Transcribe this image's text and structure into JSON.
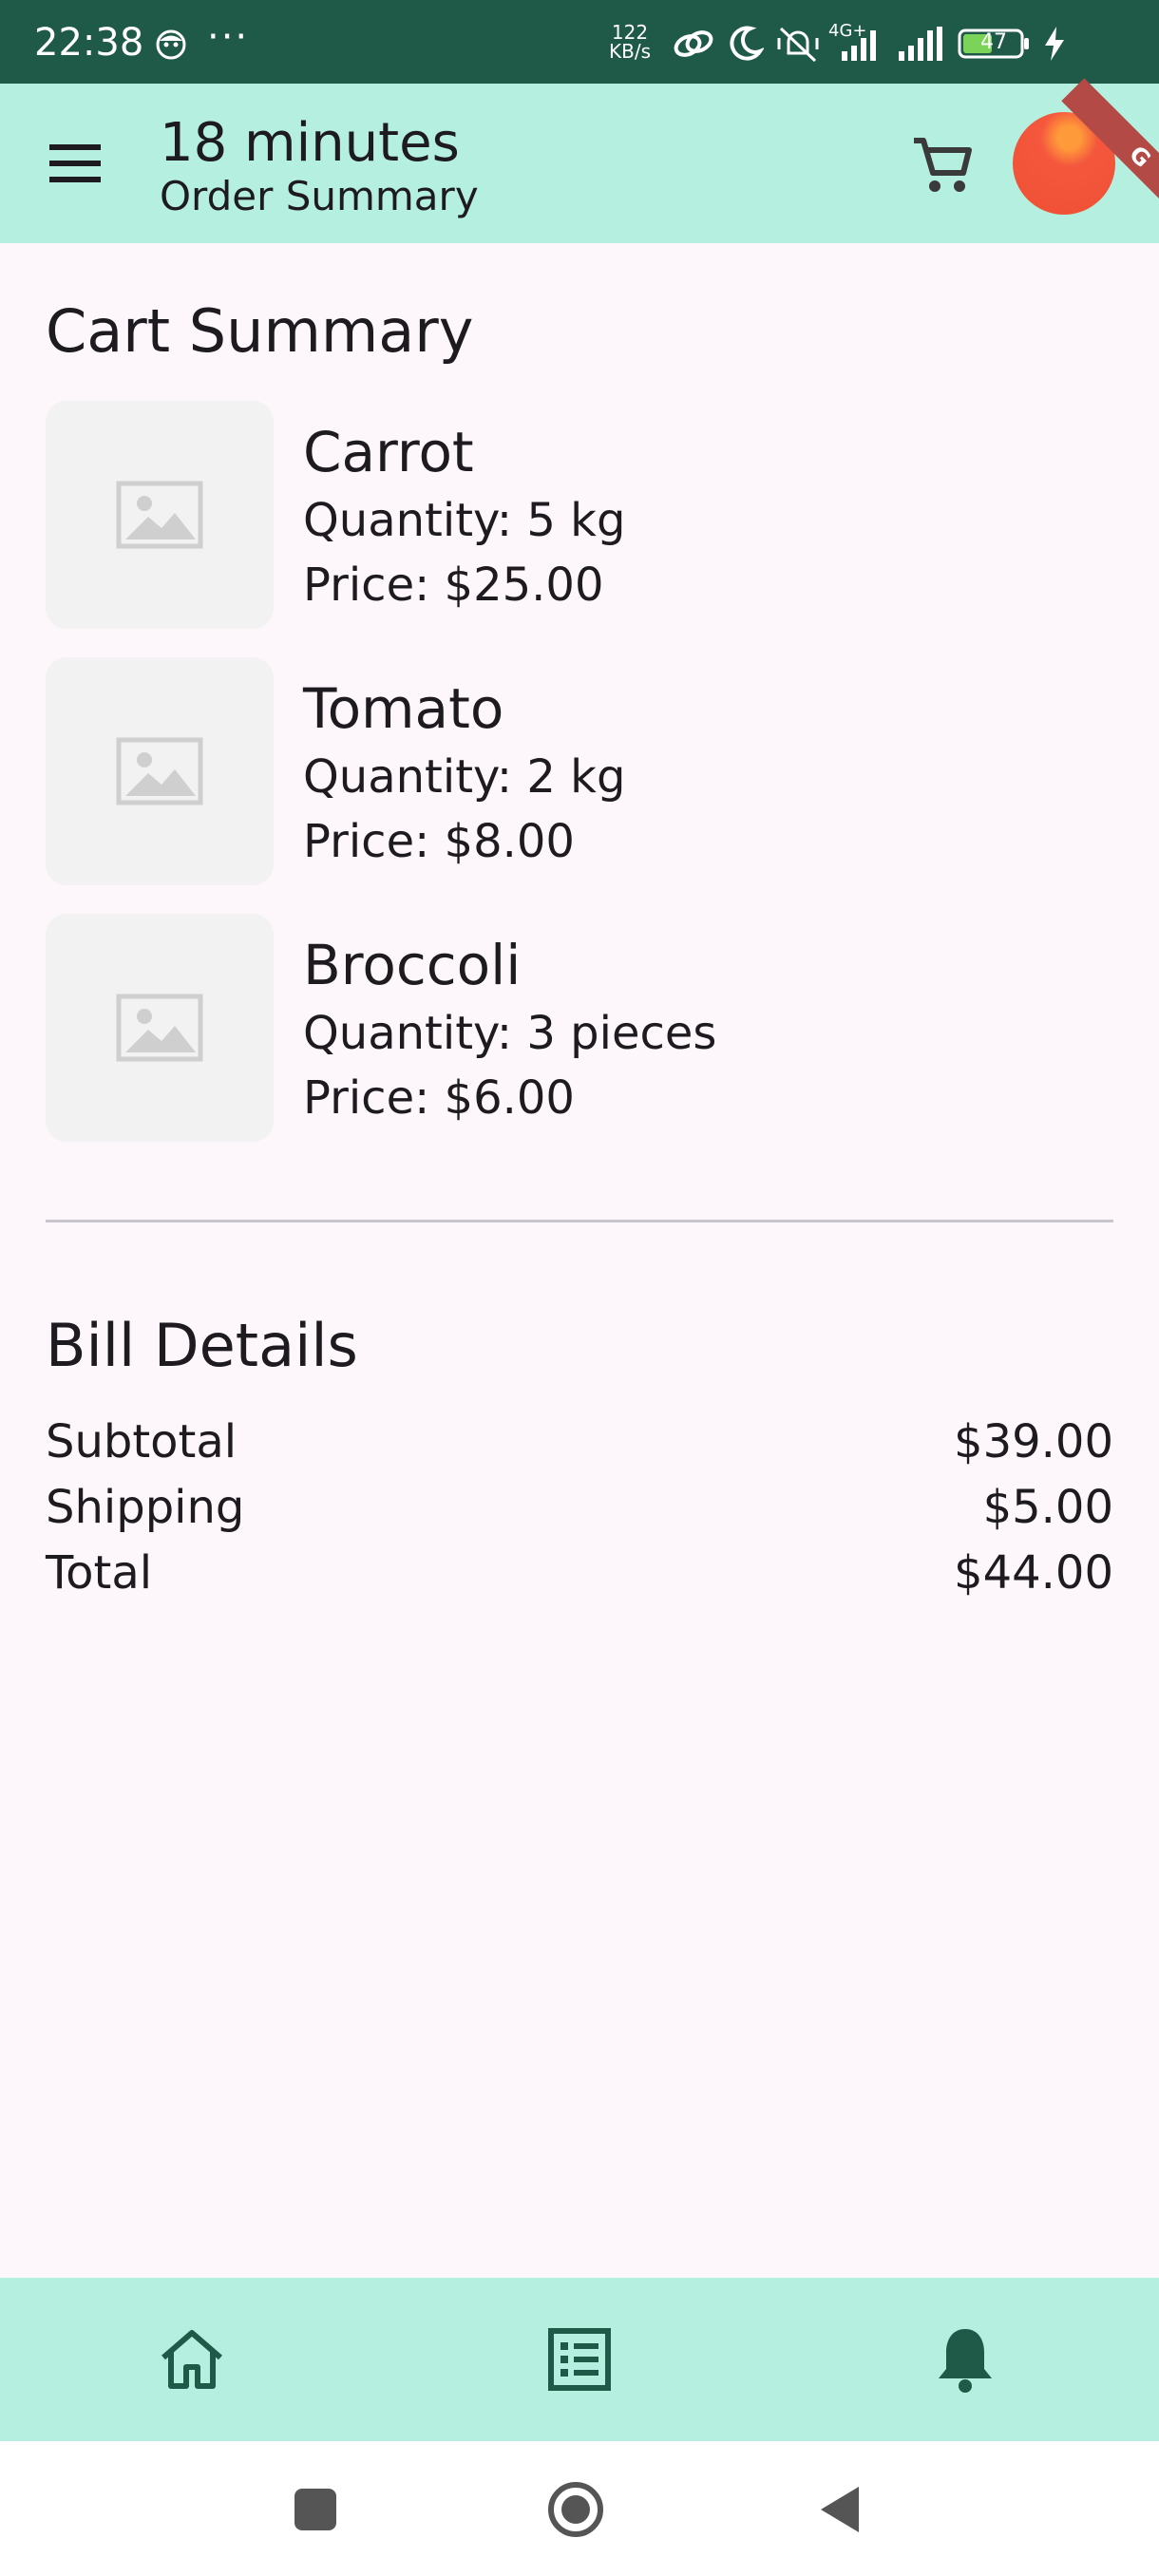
{
  "status_bar": {
    "time": "22:38",
    "dots": "···",
    "net_speed_value": "122",
    "net_speed_unit": "KB/s",
    "network": "4G+",
    "battery": "47"
  },
  "app_bar": {
    "title": "18 minutes",
    "subtitle": "Order Summary",
    "debug_banner": "G",
    "color": "#b5efdf"
  },
  "cart": {
    "title": "Cart Summary",
    "items": [
      {
        "name": "Carrot",
        "quantity": "Quantity: 5 kg",
        "price": "Price: $25.00"
      },
      {
        "name": "Tomato",
        "quantity": "Quantity: 2 kg",
        "price": "Price: $8.00"
      },
      {
        "name": "Broccoli",
        "quantity": "Quantity: 3 pieces",
        "price": "Price: $6.00"
      }
    ]
  },
  "bill": {
    "title": "Bill Details",
    "rows": [
      {
        "label": "Subtotal",
        "value": "$39.00"
      },
      {
        "label": "Shipping",
        "value": "$5.00"
      },
      {
        "label": "Total",
        "value": "$44.00"
      }
    ]
  },
  "bottom_nav": {
    "items": [
      {
        "icon": "home-icon"
      },
      {
        "icon": "list-icon",
        "selected": true
      },
      {
        "icon": "bell-icon"
      }
    ],
    "accent": "#1f5a48"
  }
}
